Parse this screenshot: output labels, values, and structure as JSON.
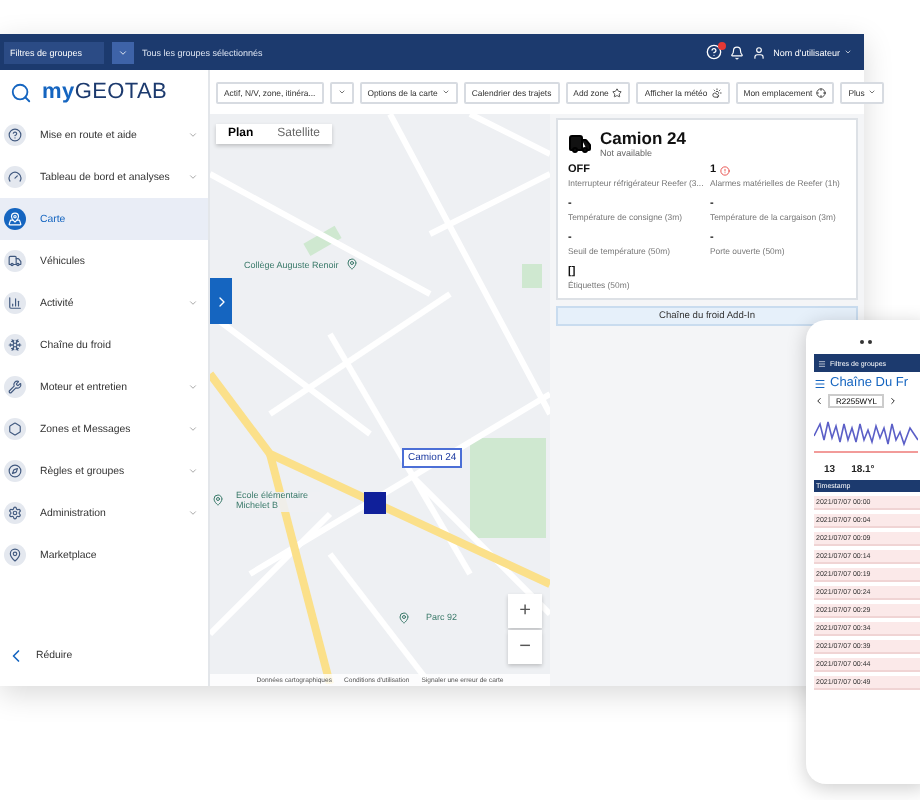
{
  "header": {
    "group_filter": "Filtres de groupes",
    "groups_selected": "Tous les groupes sélectionnés",
    "user": "Nom d'utilisateur"
  },
  "logo": "**my**GEOTAB",
  "sidebar": {
    "items": [
      {
        "label": "Mise en route et aide",
        "expandable": true,
        "selected": false
      },
      {
        "label": "Tableau de bord et analyses",
        "expandable": true,
        "selected": false
      },
      {
        "label": "Carte",
        "expandable": false,
        "selected": true
      },
      {
        "label": "Véhicules",
        "expandable": false,
        "selected": false
      },
      {
        "label": "Activité",
        "expandable": true,
        "selected": false
      },
      {
        "label": "Chaîne du froid",
        "expandable": false,
        "selected": false
      },
      {
        "label": "Moteur et entretien",
        "expandable": true,
        "selected": false
      },
      {
        "label": "Zones et Messages",
        "expandable": true,
        "selected": false
      },
      {
        "label": "Règles et groupes",
        "expandable": true,
        "selected": false
      },
      {
        "label": "Administration",
        "expandable": true,
        "selected": false
      },
      {
        "label": "Marketplace",
        "expandable": false,
        "selected": false
      }
    ],
    "collapse": "Réduire"
  },
  "toolbar": [
    {
      "label": "Actif, N/V, zone, itinéra...",
      "kind": "split"
    },
    {
      "label": "Options de la carte",
      "kind": "dropdown"
    },
    {
      "label": "Calendrier des trajets",
      "kind": "plain"
    },
    {
      "label": "Add zone",
      "kind": "star"
    },
    {
      "label": "Afficher la météo",
      "kind": "weather"
    },
    {
      "label": "Mon emplacement",
      "kind": "target"
    },
    {
      "label": "Plus",
      "kind": "dropdown"
    }
  ],
  "map": {
    "tabs": [
      {
        "label": "Plan",
        "selected": true
      },
      {
        "label": "Satellite",
        "selected": false
      }
    ],
    "places": [
      "Collège Auguste Renoir",
      "Ecole élémentaire Michelet B",
      "Parc 92"
    ],
    "vehicle_label": "Camion 24",
    "zoom_in": "+",
    "zoom_out": "−",
    "attribution": [
      "Données cartographiques",
      "Conditions d'utilisation",
      "Signaler une erreur de carte"
    ]
  },
  "panel": {
    "title": "Camion 24",
    "status": "Not available",
    "fields": [
      {
        "value": "OFF",
        "label": "Interrupteur réfrigérateur Reefer (3...",
        "alarm": false
      },
      {
        "value": "1",
        "label": "Alarmes matérielles de Reefer (1h)",
        "alarm": true
      },
      {
        "value": "-",
        "label": "Température de consigne (3m)",
        "alarm": false
      },
      {
        "value": "-",
        "label": "Température de la cargaison (3m)",
        "alarm": false
      },
      {
        "value": "-",
        "label": "Seuil de température (50m)",
        "alarm": false
      },
      {
        "value": "-",
        "label": "Porte ouverte (50m)",
        "alarm": false
      },
      {
        "value": "[]",
        "label": "Étiquettes (50m)",
        "alarm": false
      }
    ],
    "addin_button": "Chaîne du froid Add-In"
  },
  "phone": {
    "group_filter": "Filtres de groupes",
    "title": "Chaîne Du Fr",
    "vehicle": "R2255WYL",
    "stats": [
      "13",
      "18.1°"
    ],
    "column": "Timestamp",
    "rows": [
      "2021/07/07 00:00",
      "2021/07/07 00:04",
      "2021/07/07 00:09",
      "2021/07/07 00:14",
      "2021/07/07 00:19",
      "2021/07/07 00:24",
      "2021/07/07 00:29",
      "2021/07/07 00:34",
      "2021/07/07 00:39",
      "2021/07/07 00:44",
      "2021/07/07 00:49"
    ]
  }
}
